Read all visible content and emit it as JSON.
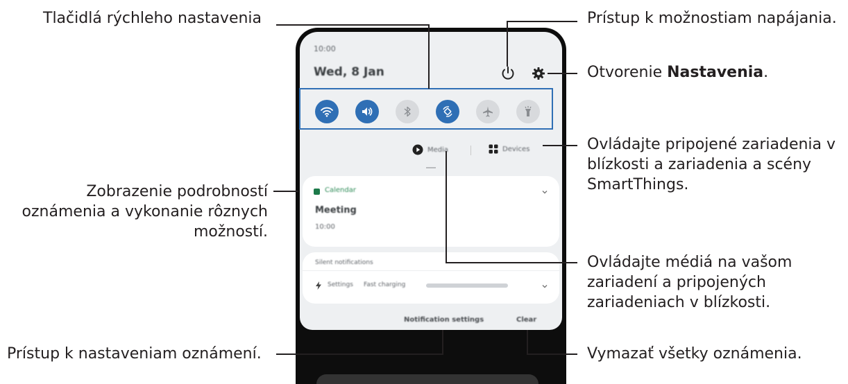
{
  "callouts": {
    "quick_settings": "Tlačidlá rýchleho nastavenia",
    "power": "Prístup k možnostiam napájania.",
    "settings_prefix": "Otvorenie ",
    "settings_bold": "Nastavenia",
    "settings_suffix": ".",
    "devices_line1": "Ovládajte pripojené zariadenia v",
    "devices_line2": "blízkosti a zariadenia a scény",
    "devices_line3": "SmartThings.",
    "notif_detail_line1": "Zobrazenie podrobností",
    "notif_detail_line2": "oznámenia a vykonanie rôznych",
    "notif_detail_line3": "možností.",
    "media_line1": "Ovládajte médiá na vašom",
    "media_line2": "zariadení a pripojených",
    "media_line3": "zariadeniach v blízkosti.",
    "notif_settings": "Prístup k nastaveniam oznámení.",
    "clear_all": "Vymazať všetky oznámenia."
  },
  "phone": {
    "time": "10:00",
    "date": "Wed, 8 Jan",
    "quick_buttons": [
      {
        "name": "wifi",
        "state": "on"
      },
      {
        "name": "sound",
        "state": "on"
      },
      {
        "name": "bluetooth",
        "state": "off"
      },
      {
        "name": "auto-rotate",
        "state": "on"
      },
      {
        "name": "airplane",
        "state": "off"
      },
      {
        "name": "flashlight",
        "state": "off"
      }
    ],
    "media_label": "Media",
    "devices_label": "Devices",
    "notification": {
      "app": "Calendar",
      "title": "Meeting",
      "time": "10:00"
    },
    "silent_header": "Silent notifications",
    "silent_item": {
      "app": "Settings",
      "text": "Fast charging"
    },
    "notification_settings": "Notification settings",
    "clear": "Clear"
  },
  "colors": {
    "accent": "#2f6fb5",
    "line": "#231f20"
  }
}
